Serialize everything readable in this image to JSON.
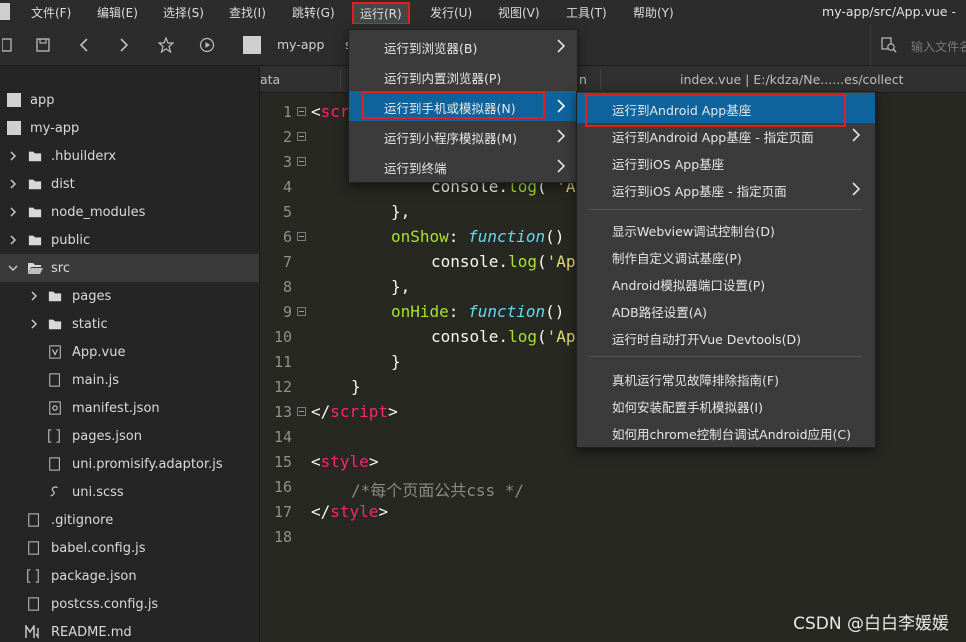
{
  "app": {
    "window_title": "my-app/src/App.vue -"
  },
  "menubar": {
    "items": [
      {
        "label": "文件(F)"
      },
      {
        "label": "编辑(E)"
      },
      {
        "label": "选择(S)"
      },
      {
        "label": "查找(I)"
      },
      {
        "label": "跳转(G)"
      },
      {
        "label": "运行(R)"
      },
      {
        "label": "发行(U)"
      },
      {
        "label": "视图(V)"
      },
      {
        "label": "工具(T)"
      },
      {
        "label": "帮助(Y)"
      }
    ]
  },
  "toolbar": {
    "breadcrumb_project": "my-app",
    "breadcrumb_partial": "s",
    "search_placeholder": "输入文件名"
  },
  "sidebar": {
    "items": [
      {
        "label": "app",
        "icon": "project-icon"
      },
      {
        "label": "my-app",
        "icon": "project-icon"
      },
      {
        "label": ".hbuilderx",
        "icon": "folder-icon"
      },
      {
        "label": "dist",
        "icon": "folder-icon"
      },
      {
        "label": "node_modules",
        "icon": "folder-icon"
      },
      {
        "label": "public",
        "icon": "folder-icon"
      },
      {
        "label": "src",
        "icon": "folder-open-icon"
      },
      {
        "label": "pages",
        "icon": "folder-icon"
      },
      {
        "label": "static",
        "icon": "folder-icon"
      },
      {
        "label": "App.vue",
        "icon": "vue-file-icon"
      },
      {
        "label": "main.js",
        "icon": "file-icon"
      },
      {
        "label": "manifest.json",
        "icon": "gear-file-icon"
      },
      {
        "label": "pages.json",
        "icon": "json-file-icon"
      },
      {
        "label": "uni.promisify.adaptor.js",
        "icon": "file-icon"
      },
      {
        "label": "uni.scss",
        "icon": "scss-file-icon"
      },
      {
        "label": ".gitignore",
        "icon": "file-icon"
      },
      {
        "label": "babel.config.js",
        "icon": "file-icon"
      },
      {
        "label": "package.json",
        "icon": "json-file-icon"
      },
      {
        "label": "postcss.config.js",
        "icon": "file-icon"
      },
      {
        "label": "README.md",
        "icon": "markdown-file-icon"
      }
    ]
  },
  "tabs": [
    {
      "label": "ata"
    },
    {
      "label": "n"
    },
    {
      "label": "index.vue | E:/kdza/Ne......es/collect"
    }
  ],
  "editor": {
    "lines": [
      {
        "n": "1",
        "fold": true
      },
      {
        "n": "2",
        "fold": true
      },
      {
        "n": "3",
        "fold": true
      },
      {
        "n": "4",
        "fold": false
      },
      {
        "n": "5",
        "fold": false
      },
      {
        "n": "6",
        "fold": true
      },
      {
        "n": "7",
        "fold": false
      },
      {
        "n": "8",
        "fold": false
      },
      {
        "n": "9",
        "fold": true
      },
      {
        "n": "10",
        "fold": false
      },
      {
        "n": "11",
        "fold": false
      },
      {
        "n": "12",
        "fold": false
      },
      {
        "n": "13",
        "fold": true
      },
      {
        "n": "14",
        "fold": false
      },
      {
        "n": "15",
        "fold": false
      },
      {
        "n": "16",
        "fold": false
      },
      {
        "n": "17",
        "fold": false
      },
      {
        "n": "18",
        "fold": false
      }
    ],
    "code": {
      "l1_open": "<",
      "l1_tag": "scri",
      "l4_a": "console.",
      "l4_b": "log",
      "l4_c": "( ",
      "l4_d": "'Ap",
      "l5": "},",
      "l6_key": "onShow",
      "l6_colon": ": ",
      "l6_kw": "function",
      "l6_rest": "()",
      "l7_a": "console.",
      "l7_b": "log",
      "l7_c": "(",
      "l7_d": "'Ap",
      "l8": "},",
      "l9_key": "onHide",
      "l9_colon": ": ",
      "l9_kw": "function",
      "l9_rest": "()",
      "l10_a": "console.",
      "l10_b": "log",
      "l10_c": "(",
      "l10_d": "'Ap",
      "l11": "}",
      "l12": "}",
      "l13_open": "</",
      "l13_tag": "script",
      "l13_close": ">",
      "l15_open": "<",
      "l15_tag": "style",
      "l15_close": ">",
      "l16": "/*每个页面公共css */",
      "l17_open": "</",
      "l17_tag": "style",
      "l17_close": ">"
    }
  },
  "run_menu": {
    "items": [
      {
        "label": "运行到浏览器(B)",
        "submenu": true
      },
      {
        "label": "运行到内置浏览器(P)",
        "submenu": false
      },
      {
        "label": "运行到手机或模拟器(N)",
        "submenu": true
      },
      {
        "label": "运行到小程序模拟器(M)",
        "submenu": true
      },
      {
        "label": "运行到终端",
        "submenu": true
      }
    ]
  },
  "device_submenu": {
    "items": [
      {
        "label": "运行到Android App基座"
      },
      {
        "label": "运行到Android App基座 - 指定页面"
      },
      {
        "label": "运行到iOS App基座"
      },
      {
        "label": "运行到iOS App基座 - 指定页面"
      },
      {
        "label": "显示Webview调试控制台(D)"
      },
      {
        "label": "制作自定义调试基座(P)"
      },
      {
        "label": "Android模拟器端口设置(P)"
      },
      {
        "label": "ADB路径设置(A)"
      },
      {
        "label": "运行时自动打开Vue Devtools(D)"
      },
      {
        "label": "真机运行常见故障排除指南(F)"
      },
      {
        "label": "如何安装配置手机模拟器(I)"
      },
      {
        "label": "如何用chrome控制台调试Android应用(C)"
      }
    ]
  },
  "watermark": "CSDN @白白李媛媛",
  "colors": {
    "highlight": "#0e639c",
    "annotation_red": "#e02020",
    "code_tag": "#f92672",
    "code_prop": "#a6e22e",
    "code_keyword": "#66d9ef"
  }
}
